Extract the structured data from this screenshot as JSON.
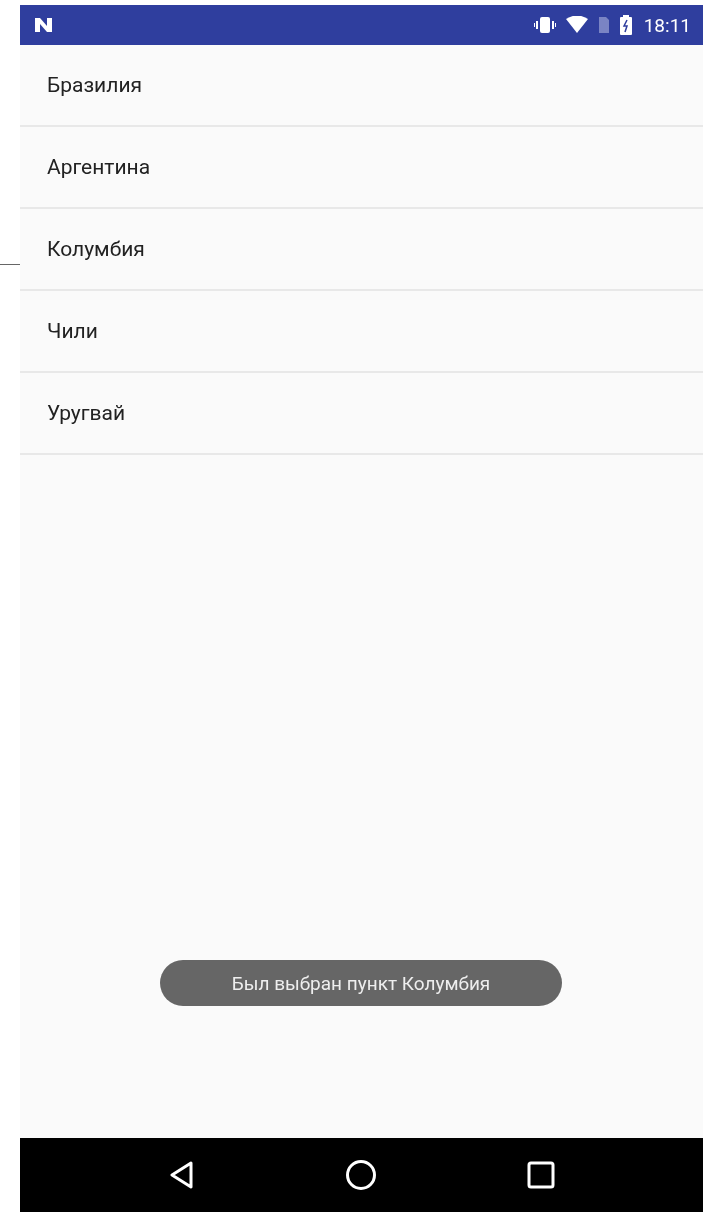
{
  "status_bar": {
    "time": "18:11"
  },
  "list": {
    "items": [
      {
        "label": "Бразилия"
      },
      {
        "label": "Аргентина"
      },
      {
        "label": "Колумбия"
      },
      {
        "label": "Чили"
      },
      {
        "label": "Уругвай"
      }
    ]
  },
  "toast": {
    "text": "Был выбран пункт Колумбия"
  }
}
